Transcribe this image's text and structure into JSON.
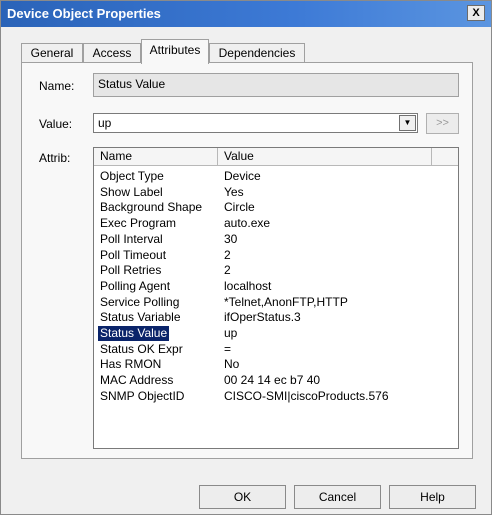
{
  "window": {
    "title": "Device Object Properties",
    "close_label": "X"
  },
  "tabs": [
    {
      "label": "General"
    },
    {
      "label": "Access"
    },
    {
      "label": "Attributes"
    },
    {
      "label": "Dependencies"
    }
  ],
  "active_tab": "Attributes",
  "form": {
    "name_label": "Name:",
    "name_value": "Status Value",
    "value_label": "Value:",
    "value_value": "up",
    "more_button": ">>",
    "attrib_label": "Attrib:"
  },
  "attrib_table": {
    "columns": [
      "Name",
      "Value"
    ],
    "selected_row": "Status Value",
    "rows": [
      {
        "name": "Object Type",
        "value": "Device"
      },
      {
        "name": "Show Label",
        "value": "Yes"
      },
      {
        "name": "Background Shape",
        "value": "Circle"
      },
      {
        "name": "Exec Program",
        "value": "auto.exe"
      },
      {
        "name": "Poll Interval",
        "value": "30"
      },
      {
        "name": "Poll Timeout",
        "value": "2"
      },
      {
        "name": "Poll Retries",
        "value": "2"
      },
      {
        "name": "Polling Agent",
        "value": "localhost"
      },
      {
        "name": "Service Polling",
        "value": "*Telnet,AnonFTP,HTTP"
      },
      {
        "name": "Status Variable",
        "value": "ifOperStatus.3"
      },
      {
        "name": "Status Value",
        "value": "up"
      },
      {
        "name": "Status OK Expr",
        "value": "="
      },
      {
        "name": "Has RMON",
        "value": "No"
      },
      {
        "name": "MAC Address",
        "value": "00 24 14 ec b7 40"
      },
      {
        "name": "SNMP ObjectID",
        "value": "CISCO-SMI|ciscoProducts.576"
      }
    ]
  },
  "buttons": {
    "ok": "OK",
    "cancel": "Cancel",
    "help": "Help"
  },
  "colors": {
    "titlebar": "#2a63b8",
    "selection": "#0a246a"
  }
}
